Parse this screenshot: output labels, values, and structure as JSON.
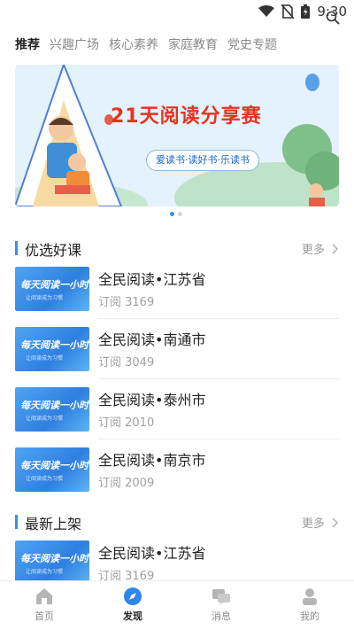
{
  "status": {
    "time": "9:30"
  },
  "tabs": [
    {
      "label": "推荐",
      "active": true
    },
    {
      "label": "兴趣广场",
      "active": false
    },
    {
      "label": "核心素养",
      "active": false
    },
    {
      "label": "家庭教育",
      "active": false
    },
    {
      "label": "党史专题",
      "active": false
    }
  ],
  "banner": {
    "title": "21天阅读分享赛",
    "subtitle": "爱读书·读好书·乐读书",
    "dots": 2,
    "active_dot": 0
  },
  "sections": {
    "featured": {
      "title": "优选好课",
      "more": "更多"
    },
    "latest": {
      "title": "最新上架",
      "more": "更多"
    }
  },
  "thumb": {
    "main": "每天阅读一小时",
    "sub": "让阅读成为习惯"
  },
  "featured_courses": [
    {
      "name": "全民阅读•江苏省",
      "subs": "订阅 3169"
    },
    {
      "name": "全民阅读•南通市",
      "subs": "订阅 3049"
    },
    {
      "name": "全民阅读•泰州市",
      "subs": "订阅 2010"
    },
    {
      "name": "全民阅读•南京市",
      "subs": "订阅 2009"
    }
  ],
  "latest_courses": [
    {
      "name": "全民阅读•江苏省",
      "subs": "订阅 3169"
    }
  ],
  "bottom_nav": [
    {
      "label": "首页",
      "icon": "home-icon",
      "active": false
    },
    {
      "label": "发现",
      "icon": "compass-icon",
      "active": true
    },
    {
      "label": "消息",
      "icon": "message-icon",
      "active": false
    },
    {
      "label": "我的",
      "icon": "profile-icon",
      "active": false
    }
  ],
  "colors": {
    "accent": "#3a8ee6",
    "title_red": "#e8321e",
    "muted": "#9a9a9a"
  }
}
